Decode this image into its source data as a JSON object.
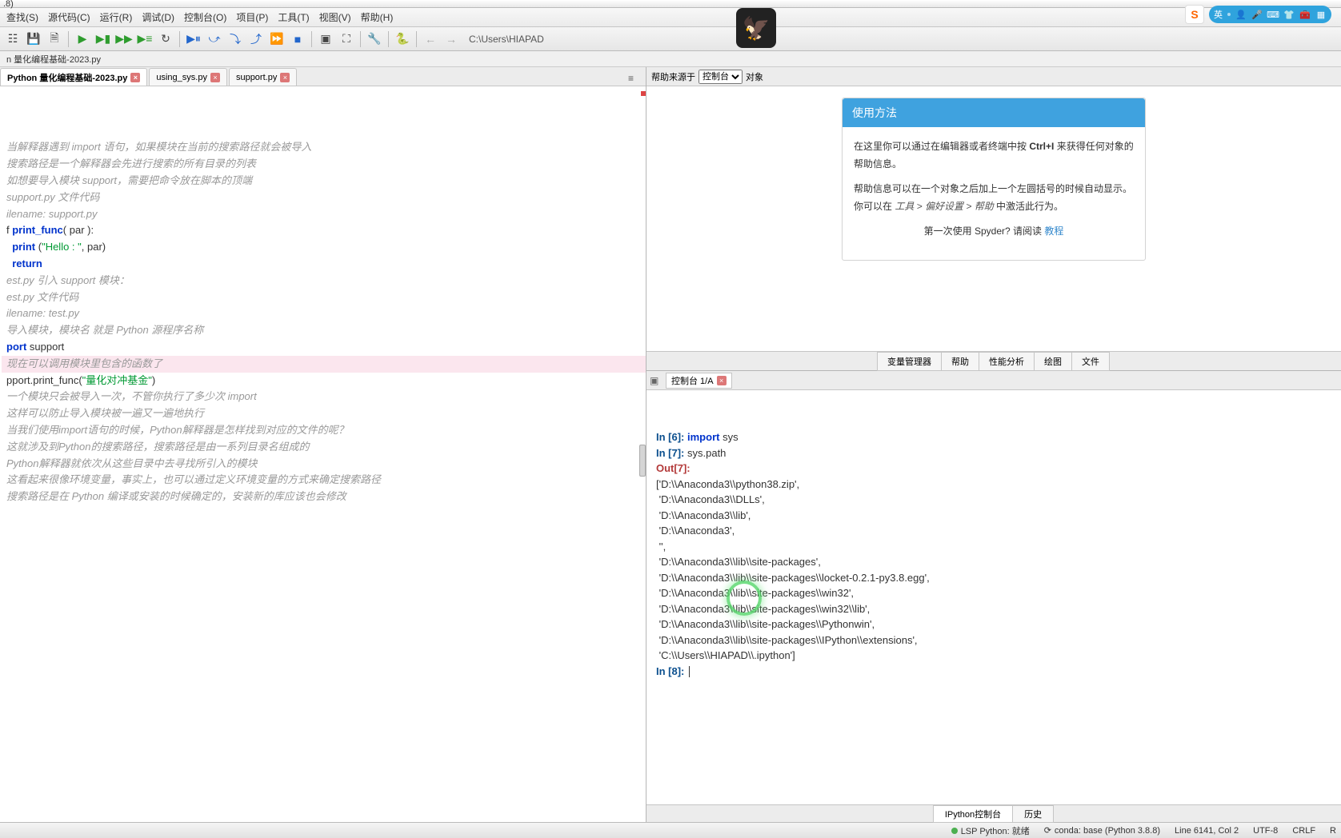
{
  "title": ".8)",
  "menu": [
    "查找(S)",
    "源代码(C)",
    "运行(R)",
    "调试(D)",
    "控制台(O)",
    "项目(P)",
    "工具(T)",
    "视图(V)",
    "帮助(H)"
  ],
  "path": "C:\\Users\\HIAPAD",
  "breadcrumb": "n 量化编程基础-2023.py",
  "tabs": [
    {
      "label": "Python 量化编程基础-2023.py",
      "active": true
    },
    {
      "label": "using_sys.py",
      "active": false
    },
    {
      "label": "support.py",
      "active": false
    }
  ],
  "code": [
    {
      "cls": "cmt",
      "txt": "当解释器遇到 import 语句，如果模块在当前的搜索路径就会被导入"
    },
    {
      "cls": "",
      "txt": ""
    },
    {
      "cls": "cmt",
      "txt": "搜索路径是一个解释器会先进行搜索的所有目录的列表"
    },
    {
      "cls": "",
      "txt": ""
    },
    {
      "cls": "cmt",
      "txt": "如想要导入模块 support，需要把命令放在脚本的顶端"
    },
    {
      "cls": "",
      "txt": ""
    },
    {
      "cls": "cmt",
      "txt": "support.py 文件代码"
    },
    {
      "cls": "",
      "txt": ""
    },
    {
      "cls": "cmt",
      "txt": "ilename: support.py"
    },
    {
      "cls": "",
      "txt": ""
    },
    {
      "cls": "def",
      "txt": "f print_func( par ):"
    },
    {
      "cls": "body",
      "txt": "  print (\"Hello : \", par)"
    },
    {
      "cls": "ret",
      "txt": "  return"
    },
    {
      "cls": "",
      "txt": ""
    },
    {
      "cls": "",
      "txt": ""
    },
    {
      "cls": "",
      "txt": ""
    },
    {
      "cls": "cmt",
      "txt": "est.py 引入 support 模块："
    },
    {
      "cls": "",
      "txt": ""
    },
    {
      "cls": "cmt",
      "txt": "est.py 文件代码"
    },
    {
      "cls": "",
      "txt": ""
    },
    {
      "cls": "cmt",
      "txt": "ilename: test.py"
    },
    {
      "cls": "",
      "txt": ""
    },
    {
      "cls": "cmt",
      "txt": "导入模块，模块名 就是 Python 源程序名称"
    },
    {
      "cls": "imp",
      "txt": "port support"
    },
    {
      "cls": "",
      "txt": ""
    },
    {
      "cls": "cmt hl",
      "txt": "现在可以调用模块里包含的函数了"
    },
    {
      "cls": "call",
      "txt": "pport.print_func(\"量化对冲基金\")"
    },
    {
      "cls": "",
      "txt": ""
    },
    {
      "cls": "",
      "txt": ""
    },
    {
      "cls": "cmt",
      "txt": "一个模块只会被导入一次，不管你执行了多少次 import"
    },
    {
      "cls": "",
      "txt": ""
    },
    {
      "cls": "cmt",
      "txt": "这样可以防止导入模块被一遍又一遍地执行"
    },
    {
      "cls": "",
      "txt": ""
    },
    {
      "cls": "cmt",
      "txt": "当我们使用import语句的时候，Python解释器是怎样找到对应的文件的呢？"
    },
    {
      "cls": "",
      "txt": ""
    },
    {
      "cls": "cmt",
      "txt": "这就涉及到Python的搜索路径，搜索路径是由一系列目录名组成的"
    },
    {
      "cls": "",
      "txt": ""
    },
    {
      "cls": "cmt",
      "txt": "Python解释器就依次从这些目录中去寻找所引入的模块"
    },
    {
      "cls": "",
      "txt": ""
    },
    {
      "cls": "cmt",
      "txt": "这看起来很像环境变量，事实上，也可以通过定义环境变量的方式来确定搜索路径"
    },
    {
      "cls": "",
      "txt": ""
    },
    {
      "cls": "cmt",
      "txt": "搜索路径是在 Python 编译或安装的时候确定的，安装新的库应该也会修改"
    }
  ],
  "help": {
    "sourceLabel": "帮助来源于",
    "sourceValue": "控制台",
    "objLabel": "对象",
    "card": {
      "title": "使用方法",
      "p1_a": "在这里你可以通过在编辑器或者终端中按 ",
      "p1_b": "Ctrl+I",
      "p1_c": " 来获得任何对象的帮助信息。",
      "p2_a": "帮助信息可以在一个对象之后加上一个左圆括号的时候自动显示。你可以在 ",
      "p2_b": "工具 > 偏好设置 > 帮助",
      "p2_c": " 中激活此行为。",
      "p3_a": "第一次使用 Spyder? 请阅读 ",
      "p3_link": "教程"
    },
    "tabs": [
      "变量管理器",
      "帮助",
      "性能分析",
      "绘图",
      "文件"
    ]
  },
  "console": {
    "tabLabel": "控制台 1/A",
    "lines": [
      "In [6]: import sys",
      "",
      "In [7]: sys.path",
      "Out[7]:",
      "['D:\\\\Anaconda3\\\\python38.zip',",
      " 'D:\\\\Anaconda3\\\\DLLs',",
      " 'D:\\\\Anaconda3\\\\lib',",
      " 'D:\\\\Anaconda3',",
      " '',",
      " 'D:\\\\Anaconda3\\\\lib\\\\site-packages',",
      " 'D:\\\\Anaconda3\\\\lib\\\\site-packages\\\\locket-0.2.1-py3.8.egg',",
      " 'D:\\\\Anaconda3\\\\lib\\\\site-packages\\\\win32',",
      " 'D:\\\\Anaconda3\\\\lib\\\\site-packages\\\\win32\\\\lib',",
      " 'D:\\\\Anaconda3\\\\lib\\\\site-packages\\\\Pythonwin',",
      " 'D:\\\\Anaconda3\\\\lib\\\\site-packages\\\\IPython\\\\extensions',",
      " 'C:\\\\Users\\\\HIAPAD\\\\.ipython']",
      "",
      "In [8]: "
    ],
    "bottomTabs": [
      "IPython控制台",
      "历史"
    ]
  },
  "status": {
    "lsp": "LSP Python: 就绪",
    "conda": "conda: base (Python 3.8.8)",
    "line": "Line 6141, Col 2",
    "enc": "UTF-8",
    "eol": "CRLF",
    "rw": "R"
  },
  "badges": {
    "sogou": "S",
    "lang": "英"
  }
}
